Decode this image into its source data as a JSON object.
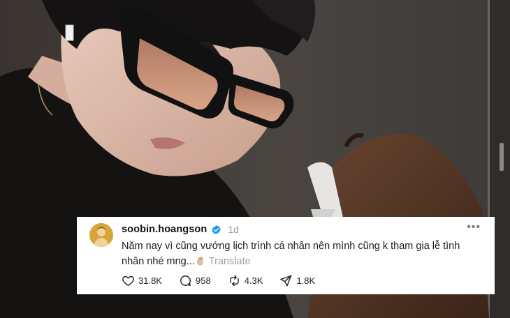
{
  "post": {
    "username": "soobin.hoangson",
    "timestamp": "1d",
    "text_line1": "Năm nay vì cũng vướng lịch trình cá nhân nên mình cũng k tham gia lễ tình",
    "text_line2": "nhân nhé mng...",
    "translate": "Translate",
    "more": "•••",
    "verified": true,
    "avatar_icon": "profile-photo",
    "emoji_icon": "raised-hand-emoji"
  },
  "actions": {
    "likes": "31.8K",
    "replies": "958",
    "reposts": "4.3K",
    "shares": "1.8K"
  },
  "colors": {
    "verified": "#1d9bf0",
    "card_bg": "#ffffff",
    "muted": "#9a9a9a",
    "avatar_bg": "#d8a53a"
  }
}
